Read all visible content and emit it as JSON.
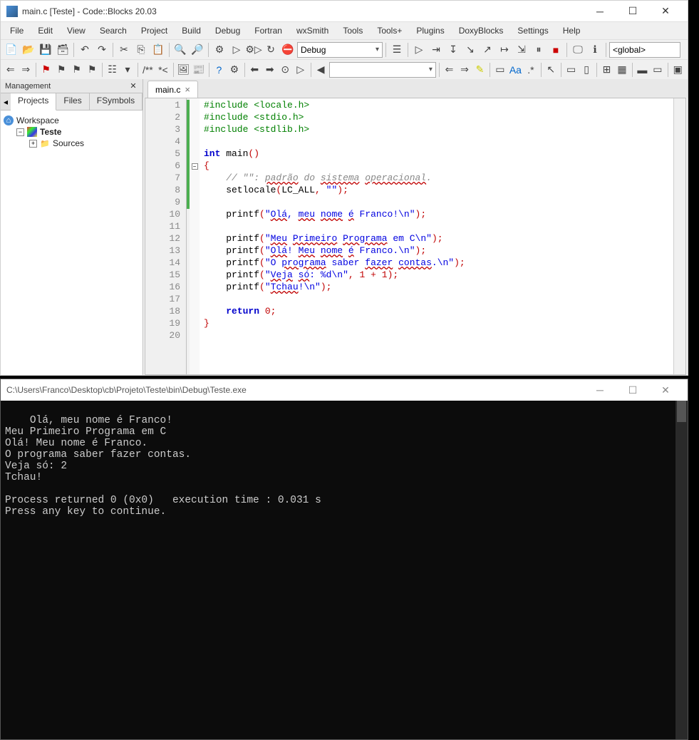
{
  "window": {
    "title": "main.c [Teste] - Code::Blocks 20.03"
  },
  "menubar": [
    "File",
    "Edit",
    "View",
    "Search",
    "Project",
    "Build",
    "Debug",
    "Fortran",
    "wxSmith",
    "Tools",
    "Tools+",
    "Plugins",
    "DoxyBlocks",
    "Settings",
    "Help"
  ],
  "toolbar": {
    "build_target": "Debug",
    "scope": "<global>",
    "search_value": ""
  },
  "management": {
    "title": "Management",
    "tabs": [
      "Projects",
      "Files",
      "FSymbols"
    ],
    "active_tab": 0,
    "tree": {
      "workspace": "Workspace",
      "project": "Teste",
      "folder": "Sources"
    }
  },
  "editor": {
    "tab_name": "main.c",
    "lines": [
      {
        "n": 1,
        "chg": true,
        "html": "<span class='pp'>#include &lt;locale.h&gt;</span>"
      },
      {
        "n": 2,
        "chg": true,
        "html": "<span class='pp'>#include &lt;stdio.h&gt;</span>"
      },
      {
        "n": 3,
        "chg": true,
        "html": "<span class='pp'>#include &lt;stdlib.h&gt;</span>"
      },
      {
        "n": 4,
        "chg": true,
        "html": ""
      },
      {
        "n": 5,
        "chg": true,
        "html": "<span class='kw'>int</span> main<span class='op'>()</span>"
      },
      {
        "n": 6,
        "chg": true,
        "fold": true,
        "html": "<span class='op'>{</span>"
      },
      {
        "n": 7,
        "chg": true,
        "html": "    <span class='cmt'>// \"\": <span class='wavy'>padrão</span> do <span class='wavy'>sistema</span> <span class='wavy'>operacional</span>.</span>"
      },
      {
        "n": 8,
        "chg": true,
        "html": "    setlocale<span class='op'>(</span>LC_ALL<span class='op'>,</span> <span class='str'>\"\"</span><span class='op'>);</span>"
      },
      {
        "n": 9,
        "chg": true,
        "html": ""
      },
      {
        "n": 10,
        "chg": false,
        "html": "    printf<span class='op'>(</span><span class='str'>\"<span class='wavy'>Olá</span>, <span class='wavy'>meu</span> <span class='wavy'>nome</span> <span class='wavy'>é</span> Franco!\\n\"</span><span class='op'>);</span>"
      },
      {
        "n": 11,
        "chg": false,
        "html": ""
      },
      {
        "n": 12,
        "chg": false,
        "html": "    printf<span class='op'>(</span><span class='str'>\"<span class='wavy'>Meu</span> <span class='wavy'>Primeiro</span> <span class='wavy'>Programa</span> em C\\n\"</span><span class='op'>);</span>"
      },
      {
        "n": 13,
        "chg": false,
        "html": "    printf<span class='op'>(</span><span class='str'>\"<span class='wavy'>Olá</span>! <span class='wavy'>Meu</span> <span class='wavy'>nome</span> <span class='wavy'>é</span> Franco.\\n\"</span><span class='op'>);</span>"
      },
      {
        "n": 14,
        "chg": false,
        "html": "    printf<span class='op'>(</span><span class='str'>\"O <span class='wavy'>programa</span> saber <span class='wavy'>fazer</span> <span class='wavy'>contas</span>.\\n\"</span><span class='op'>);</span>"
      },
      {
        "n": 15,
        "chg": false,
        "html": "    printf<span class='op'>(</span><span class='str'>\"<span class='wavy'>Veja</span> <span class='wavy'>só</span>: %d\\n\"</span><span class='op'>,</span> <span class='num'>1</span> <span class='op'>+</span> <span class='num'>1</span><span class='op'>);</span>"
      },
      {
        "n": 16,
        "chg": false,
        "html": "    printf<span class='op'>(</span><span class='str'>\"<span class='wavy'>Tchau</span>!\\n\"</span><span class='op'>);</span>"
      },
      {
        "n": 17,
        "chg": false,
        "html": ""
      },
      {
        "n": 18,
        "chg": false,
        "html": "    <span class='kw'>return</span> <span class='num'>0</span><span class='op'>;</span>"
      },
      {
        "n": 19,
        "chg": false,
        "html": "<span class='op'>}</span>"
      },
      {
        "n": 20,
        "chg": false,
        "html": ""
      }
    ]
  },
  "console": {
    "title": "C:\\Users\\Franco\\Desktop\\cb\\Projeto\\Teste\\bin\\Debug\\Teste.exe",
    "output": "Olá, meu nome é Franco!\nMeu Primeiro Programa em C\nOlá! Meu nome é Franco.\nO programa saber fazer contas.\nVeja só: 2\nTchau!\n\nProcess returned 0 (0x0)   execution time : 0.031 s\nPress any key to continue."
  }
}
